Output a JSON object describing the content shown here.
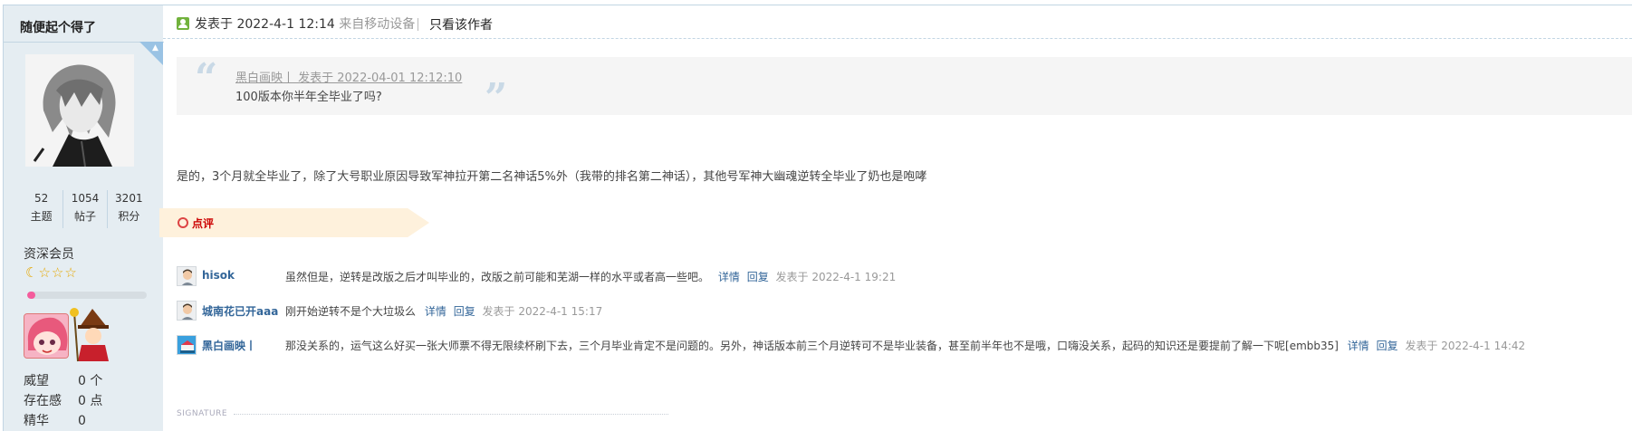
{
  "author": {
    "name": "随便起个得了",
    "stats": [
      {
        "num": "52",
        "label": "主题"
      },
      {
        "num": "1054",
        "label": "帖子"
      },
      {
        "num": "3201",
        "label": "积分"
      }
    ],
    "group": "资深会员",
    "level_progress_percent": 7,
    "info": [
      {
        "k": "威望",
        "v": "0 个"
      },
      {
        "k": "存在感",
        "v": "0 点"
      },
      {
        "k": "精华",
        "v": "0"
      }
    ]
  },
  "header": {
    "post_time": "发表于 2022-4-1 12:14",
    "source": "来自移动设备",
    "author_only": "只看该作者"
  },
  "quote": {
    "meta": "黑白画映丨 发表于 2022-04-01 12:12:10",
    "text": "100版本你半年全毕业了吗?"
  },
  "body_text": "是的，3个月就全毕业了，除了大号职业原因导致军神拉开第二名神话5%外（我带的排名第二神话），其他号军神大幽魂逆转全毕业了奶也是咆哮",
  "comment_section": {
    "label": "点评"
  },
  "comments": [
    {
      "user": "hisok",
      "text": "虽然但是，逆转是改版之后才叫毕业的，改版之前可能和芜湖一样的水平或者高一些吧。",
      "detail": "详情",
      "reply": "回复",
      "time": "发表于 2022-4-1 19:21"
    },
    {
      "user": "城南花已开aaa",
      "text": "刚开始逆转不是个大垃圾么",
      "detail": "详情",
      "reply": "回复",
      "time": "发表于 2022-4-1 15:17"
    },
    {
      "user": "黑白画映丨",
      "text": "那没关系的，运气这么好买一张大师票不得无限续杯刷下去，三个月毕业肯定不是问题的。另外，神话版本前三个月逆转可不是毕业装备，甚至前半年也不是哦，口嗨没关系，起码的知识还是要提前了解一下呢[embb35]",
      "detail": "详情",
      "reply": "回复",
      "time": "发表于 2022-4-1 14:42"
    }
  ],
  "signature_label": "SIGNATURE"
}
